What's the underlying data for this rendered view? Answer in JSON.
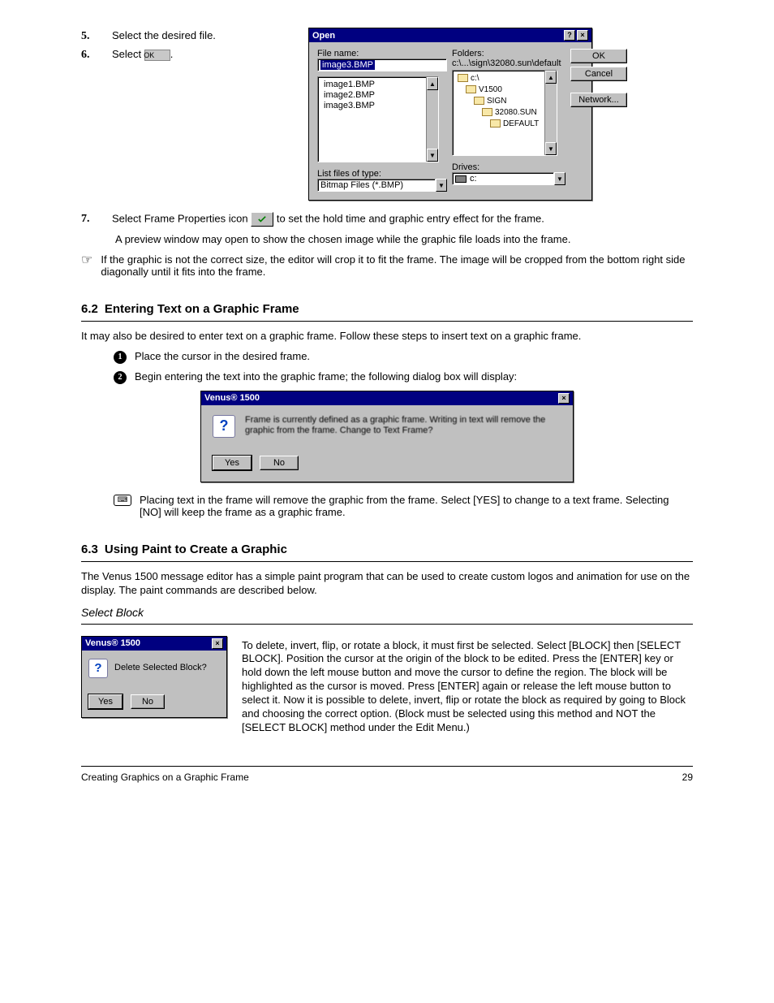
{
  "section1": {
    "steps": {
      "s5": {
        "num": "5.",
        "text": "Select the desired file."
      },
      "s6": {
        "num": "6.",
        "text": "Select"
      },
      "s7": {
        "num": "7.",
        "text": "Select Frame Properties icon"
      }
    },
    "post": {
      "p1": "to set the hold time and graphic entry effect for the frame.",
      "p2": "A preview window may open to show the chosen image while the graphic file loads into the frame."
    },
    "hand_note": "If the graphic is not the correct size, the editor will crop it to fit the frame. The image will be cropped from the bottom right side diagonally until it fits into the frame."
  },
  "open_dialog": {
    "title": "Open",
    "help_btn": "?",
    "close_btn": "×",
    "file_name_label": "File name:",
    "file_name_value": "image3.BMP",
    "files": [
      "image1.BMP",
      "image2.BMP",
      "image3.BMP"
    ],
    "folders_label": "Folders:",
    "folders_path": "c:\\...\\sign\\32080.sun\\default",
    "folder_tree": [
      "c:\\",
      "V1500",
      "SIGN",
      "32080.SUN",
      "DEFAULT"
    ],
    "list_files_label": "List files of type:",
    "list_files_value": "Bitmap Files (*.BMP)",
    "drives_label": "Drives:",
    "drives_value": "c:",
    "ok_btn": "OK",
    "cancel_btn": "Cancel",
    "network_btn": "Network..."
  },
  "section2": {
    "num": "6.2",
    "title": "Entering Text on a Graphic Frame",
    "p1": "It may also be desired to enter text on a graphic frame. Follow these steps to insert text on a graphic frame.",
    "b1": "Place the cursor in the desired frame.",
    "b2": "Begin entering the text into the graphic frame; the following dialog box will display:",
    "kb_note": "Placing text in the frame will remove the graphic from the frame. Select [YES] to change to a text frame. Selecting [NO] will keep the frame as a graphic frame."
  },
  "msg_dialog1": {
    "title": "Venus® 1500",
    "text": "Frame is currently defined as a graphic frame. Writing in text will remove the graphic from the frame. Change to Text Frame?",
    "yes": "Yes",
    "no": "No"
  },
  "section3": {
    "num": "6.3",
    "title": "Using Paint to Create a Graphic",
    "p1": "The Venus 1500 message editor has a simple paint program that can be used to create custom logos and animation for use on the display. The paint commands are described below.",
    "sub": "Select Block",
    "p2": "To delete, invert, flip, or rotate a block, it must first be selected. Select [BLOCK] then [SELECT BLOCK]. Position the cursor at the origin of the block to be edited. Press the [ENTER] key or hold down the left mouse button and move the cursor to define the region. The block will be highlighted as the cursor is moved. Press [ENTER] again or release the left mouse button to select it. Now it is possible to delete, invert, flip or rotate the block as required by going to Block and choosing the correct option. (Block must be selected using this method and NOT the [SELECT BLOCK] method under the Edit Menu.)"
  },
  "msg_dialog2": {
    "title": "Venus® 1500",
    "text": "Delete Selected Block?",
    "yes": "Yes",
    "no": "No"
  },
  "footer": {
    "left": "Creating Graphics on a Graphic Frame",
    "right": "29"
  }
}
